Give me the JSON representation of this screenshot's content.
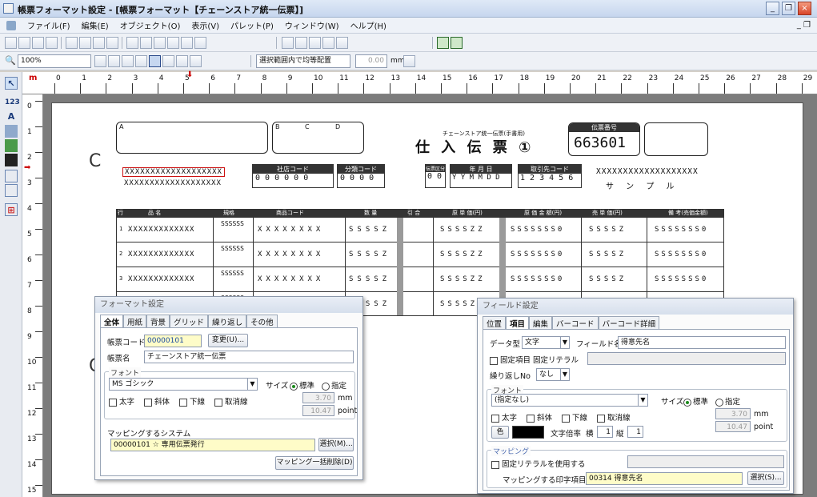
{
  "window": {
    "title": "帳票フォーマット設定 - [帳票フォーマット【チェーンストア統一伝票】]",
    "minimize": "_",
    "restore": "❐",
    "close": "×"
  },
  "menu": {
    "items": [
      "ファイル(F)",
      "編集(E)",
      "オブジェクト(O)",
      "表示(V)",
      "パレット(P)",
      "ウィンドウ(W)",
      "ヘルプ(H)"
    ],
    "mdi_controls": "_ ❐"
  },
  "toolbar": {
    "zoom": "100%",
    "align_select": "選択範囲内で均等配置",
    "spacing_value": "0.00",
    "spacing_unit": "mm"
  },
  "tools": [
    "A",
    "123"
  ],
  "ruler": {
    "h_numbers": [
      "0",
      "1",
      "2",
      "3",
      "4",
      "5",
      "6",
      "7",
      "8",
      "9",
      "10",
      "11",
      "12",
      "13",
      "14",
      "15",
      "16",
      "17",
      "18",
      "19",
      "20",
      "21",
      "22",
      "23",
      "24",
      "25",
      "26",
      "27",
      "28",
      "29"
    ],
    "v_numbers": [
      "0",
      "1",
      "2",
      "3",
      "4",
      "5",
      "6",
      "7",
      "8",
      "9",
      "10",
      "11",
      "12",
      "13",
      "14",
      "15"
    ],
    "unit": "m"
  },
  "form": {
    "subtitle": "チェーンストア統一伝票(手書用)",
    "title": "仕 入 伝 票 ①",
    "voucher_label": "伝票番号",
    "voucher_no": "663601",
    "label_a": "A",
    "label_b": "B",
    "label_c": "C",
    "label_d": "D",
    "store_name": "XXXXXXXXXXXXXXXXXXX",
    "store_name2": "XXXXXXXXXXXXXXXXXXX",
    "company_code_label": "社店コード",
    "company_code": "0 0 0 0 0 0",
    "class_code_label": "分類コード",
    "class_code": "0 0 0 0",
    "kind_label": "伝票区分",
    "kind": "0 0",
    "date_label": "年 月 日",
    "date": "Y Y M M D D",
    "supplier_code_label": "取引先コード",
    "supplier_code": "1 2 3 4 5 6",
    "supplier_name": "XXXXXXXXXXXXXXXXXXX",
    "supplier_name2": "サ ン プ ル",
    "col_no": "行",
    "col_item": "品 名",
    "col_std": "規格",
    "col_code": "商品コード",
    "col_qty": "数 量",
    "col_cnt": "引 合",
    "col_cost": "原 単 価(円)",
    "col_costamt": "原 価 金 額(円)",
    "col_price": "売 単 価(円)",
    "col_remark": "備 考(売価金額)",
    "row_item": "XXXXXXXXXXXXX",
    "row_std": "SSSSSS",
    "row_code": "XXXXXXXX",
    "row_qty": "SSSSZ",
    "row_cost": "SSSSZZ",
    "row_costamt": "SSSSSSS0",
    "row_price": "SSSSZ",
    "row_remark": "SSSSSSS0",
    "row_numbers": [
      "1",
      "2",
      "3",
      "4"
    ],
    "c_mark": "C"
  },
  "format_dialog": {
    "title": "フォーマット設定",
    "tabs": [
      "全体",
      "用紙",
      "背景",
      "グリッド",
      "繰り返し",
      "その他"
    ],
    "form_code_label": "帳票コード",
    "form_code": "00000101",
    "change_btn": "変更(U)...",
    "form_name_label": "帳票名",
    "form_name": "チェーンストア統一伝票",
    "font_group": "フォント",
    "font_name": "MS ゴシック",
    "size_label": "サイズ",
    "size_standard": "標準",
    "size_custom": "指定",
    "bold": "太字",
    "italic": "斜体",
    "underline": "下線",
    "strike": "取消線",
    "size_mm": "3.70",
    "unit_mm": "mm",
    "size_pt": "10.47",
    "unit_pt": "point",
    "mapping_label": "マッピングするシステム",
    "mapping_value": "00000101 ☆ 専用伝票発行",
    "select_btn": "選択(M)...",
    "bulk_delete_btn": "マッピング一括削除(D)"
  },
  "field_dialog": {
    "title": "フィールド設定",
    "tabs": [
      "位置",
      "項目",
      "編集",
      "バーコード",
      "バーコード詳細"
    ],
    "datatype_label": "データ型",
    "datatype": "文字",
    "fieldname_label": "フィールド名",
    "fieldname": "得意先名",
    "fixed_item": "固定項目",
    "fixed_literal_label": "固定リテラル",
    "repeat_label": "繰り返しNo",
    "repeat_value": "なし",
    "font_group": "フォント",
    "font_name": "(指定なし)",
    "size_label": "サイズ",
    "size_standard": "標準",
    "size_custom": "指定",
    "bold": "太字",
    "italic": "斜体",
    "underline": "下線",
    "strike": "取消線",
    "size_mm": "3.70",
    "unit_mm": "mm",
    "size_pt": "10.47",
    "unit_pt": "point",
    "color_btn": "色",
    "char_ratio_label": "文字倍率",
    "width_label": "横",
    "width_value": "1",
    "height_label": "縦",
    "height_value": "1",
    "mapping_group": "マッピング",
    "use_fixed_literal": "固定リテラルを使用する",
    "print_item_label": "マッピングする印字項目",
    "print_item": "00314 得意先名",
    "select_btn": "選択(S)..."
  },
  "colors": {
    "accent": "#1b8a1b",
    "highlight_red": "#cc1111",
    "yellow_input": "#fefcc8"
  }
}
